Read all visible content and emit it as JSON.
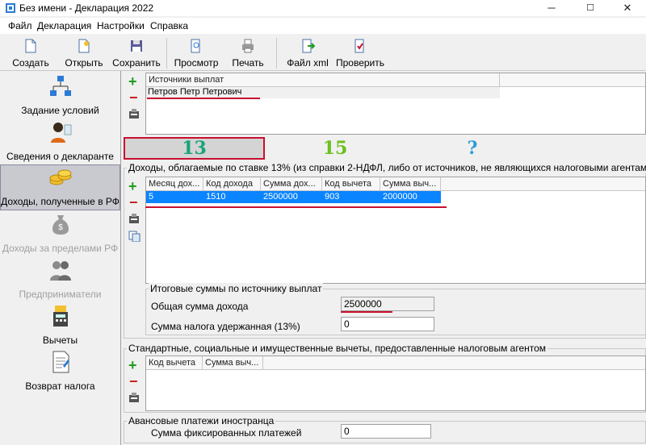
{
  "window": {
    "title": "Без имени - Декларация 2022",
    "controls": [
      "─",
      "☐",
      "✕"
    ]
  },
  "menu": [
    "Файл",
    "Декларация",
    "Настройки",
    "Справка"
  ],
  "toolbar": {
    "create": "Создать",
    "open": "Открыть",
    "save": "Сохранить",
    "preview": "Просмотр",
    "print": "Печать",
    "xml": "Файл xml",
    "check": "Проверить"
  },
  "nav": {
    "items": [
      {
        "label": "Задание условий",
        "icon": "hierarchy-icon"
      },
      {
        "label": "Сведения о декларанте",
        "icon": "person-icon"
      },
      {
        "label": "Доходы, полученные в РФ",
        "icon": "coins-icon"
      },
      {
        "label": "Доходы за пределами РФ",
        "icon": "money-bag-icon"
      },
      {
        "label": "Предприниматели",
        "icon": "people-icon"
      },
      {
        "label": "Вычеты",
        "icon": "calculator-icon"
      },
      {
        "label": "Возврат налога",
        "icon": "document-icon"
      }
    ]
  },
  "sources": {
    "header": "Источники выплат",
    "rows": [
      "Петров Петр Петрович"
    ]
  },
  "rate_tabs": [
    "13",
    "15",
    "?"
  ],
  "income": {
    "title": "Доходы, облагаемые по ставке 13% (из справки 2-НДФЛ, либо от источников, не являющихся налоговыми агентами)",
    "columns": [
      "Месяц дох...",
      "Код дохода",
      "Сумма дох...",
      "Код вычета",
      "Сумма выч..."
    ],
    "rows": [
      [
        "5",
        "1510",
        "2500000",
        "903",
        "2000000"
      ]
    ]
  },
  "totals": {
    "title": "Итоговые суммы по источнику выплат",
    "total_income_label": "Общая сумма дохода",
    "total_income_value": "2500000",
    "tax_withheld_label": "Сумма налога удержанная (13%)",
    "tax_withheld_value": "0"
  },
  "deductions": {
    "title": "Стандартные, социальные и имущественные вычеты, предоставленные налоговым агентом",
    "columns": [
      "Код вычета",
      "Сумма выч..."
    ]
  },
  "advance": {
    "title": "Авансовые платежи иностранца",
    "fixed_label": "Сумма фиксированных платежей",
    "fixed_value": "0"
  },
  "colors": {
    "accent_red": "#c8102e",
    "selection_blue": "#0a84ff",
    "plus_green": "#1f9d1f"
  }
}
